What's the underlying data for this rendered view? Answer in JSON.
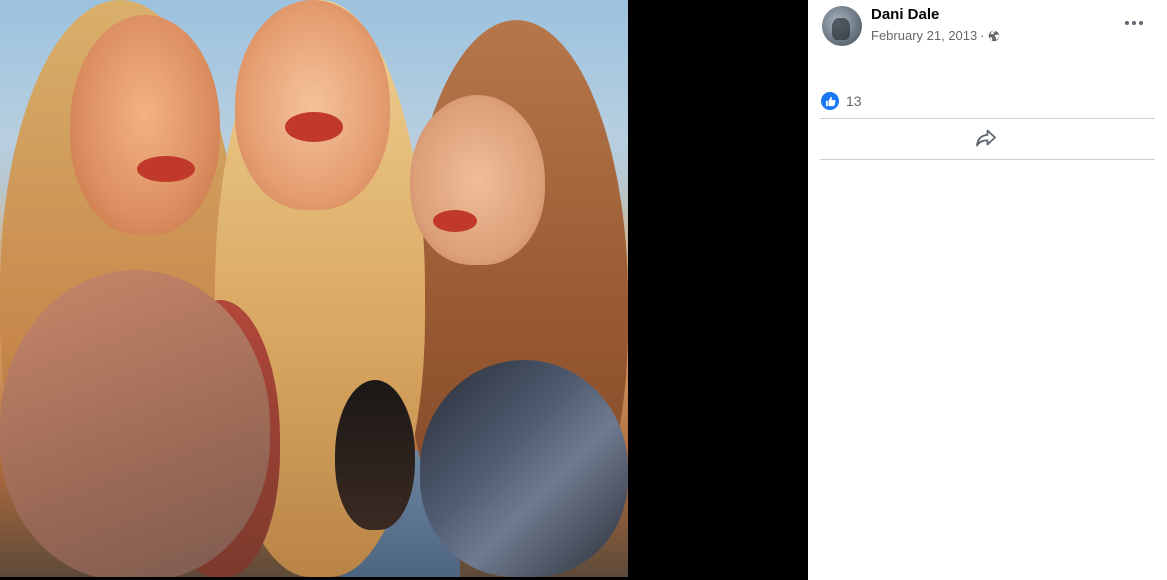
{
  "post": {
    "author": "Dani Dale",
    "date": "February 21, 2013",
    "separator": "·",
    "audience_icon": "globe-icon",
    "more_icon": "more-options-icon"
  },
  "reactions": {
    "icon": "like-icon",
    "count": "13",
    "color": "#1877f2"
  },
  "actions": {
    "share_icon": "share-icon"
  },
  "photo": {
    "description_icon": "photo"
  }
}
